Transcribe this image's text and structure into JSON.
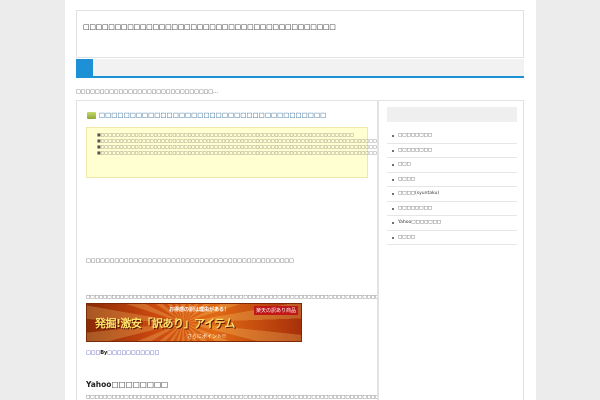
{
  "header": {
    "site_title": "□□□□□□□□□□□□□□□□□□□□□□□□□□□□□□□□□□□□□□□□"
  },
  "tagline": "□□□□□□□□□□□□□□□□□□□□□□□□□□□□□…",
  "post": {
    "title": "□□□□□□□□□□□□□□□□□□□□□□□□□□□□□□□□□□□□□",
    "notice_lines": [
      "■□□□□□□□□□□□□□□□□□□□□□□□□□□□□□□□□□□□□□□□□□□□□□□□□□□□□□□□□□□□□□□□□□□□",
      "■□□□□□□□□□□□□□□□□□□□□□□□□□□□□□□□□□□□□□□□□□□□□□□□□□□□□□□□□□□□□□□□□□□□□□□□□□□□□□□□□□□□□□□□□□□□□□□□□□□□□□□□□□□□□",
      "■□□□□□□□□□□□□□□□□□□□□□□□□□□□□□□□□□□□□□□□□□□□□□□□□□□□□□□□□□□□□□□□□□□□□□□□□□□□□□□□□□□□□□□□□□□□□□□□□□□□□□□□□□□□□□□□□□□□□□□□□□□□□□□□□□□□□□□□□□□□□□□□□□□□□□□□□",
      "■□□□□□□□□□□□□□□□□□□□□□□□□□□□□□□□□□□□□□□□□□□□□□□□□□□□□□□□□□□□□□□□□□□□□□□□□□□"
    ],
    "para1": "□□□□□□□□□□□□□□□□□□□□□□□□□□□□□□□□□□□□□□□□□□□□",
    "para2": "□□□□□□□□□□□□□□□□□□□□□□□□□□□□□□□□□□□□□□□□□□□□□□□□□□□□□□□□□□□□□□□□□□□□□□□□□□□□□□□□□□□□□□□□□□□□□□□□□□□□□□□□□□□□",
    "banner": {
      "top_text": "お得感の訳は理由がある！",
      "main_text": "発掘!激安「訳あり」アイテム",
      "corner_text": "楽天の訳あり商品",
      "sub_text": "さらにポイント!!"
    },
    "by_prefix": "□□□",
    "by_label": "By",
    "by_link": "□□□□□□□□□□□",
    "section_heading": "Yahoo□□□□□□□□",
    "para3": "□□□□□□□□□□□□□□□□□□□□□□□□□□□□□□□□□□□□□□□□□□□□□□□□□□□□□□□□□□□□□□□□□□□□□□□□□□□□□□□□□□□□□□□□□□□□□□□□□□□□□□□□□□□□□□□□□□□□□□□"
  },
  "sidebar": {
    "items": [
      "□□□□□□□□",
      "□□□□□□□□",
      "□□□",
      "□□□□",
      "□□□□(syuntaku)",
      "□□□□□□□□",
      "Yahoo□□□□□□□",
      "□□□□"
    ]
  },
  "colors": {
    "accent": "#1d90d6",
    "notice_bg": "#ffffd1",
    "link": "#1a5a8c"
  }
}
